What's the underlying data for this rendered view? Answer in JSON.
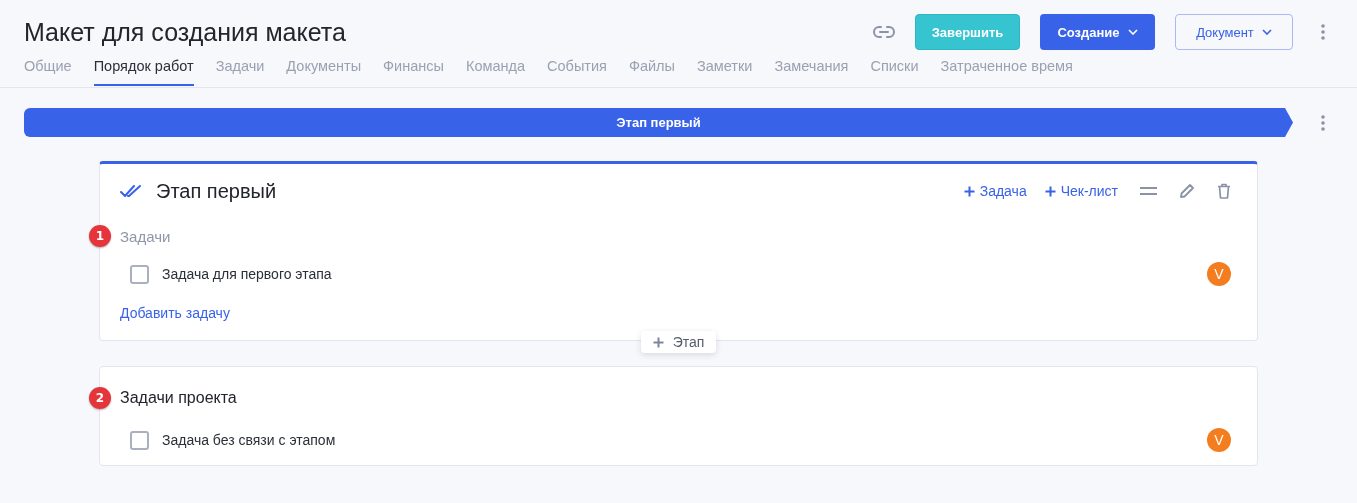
{
  "header": {
    "title": "Макет для создания макета",
    "buttons": [
      {
        "label": "Завершить",
        "kind": "teal",
        "dropdown": false
      },
      {
        "label": "Создание",
        "kind": "primary",
        "dropdown": true
      },
      {
        "label": "Документ",
        "kind": "outline",
        "dropdown": true
      }
    ]
  },
  "tabs": [
    {
      "label": "Общие",
      "selected": false
    },
    {
      "label": "Порядок работ",
      "selected": true
    },
    {
      "label": "Задачи",
      "selected": false
    },
    {
      "label": "Документы",
      "selected": false
    },
    {
      "label": "Финансы",
      "selected": false
    },
    {
      "label": "Команда",
      "selected": false
    },
    {
      "label": "События",
      "selected": false
    },
    {
      "label": "Файлы",
      "selected": false
    },
    {
      "label": "Заметки",
      "selected": false
    },
    {
      "label": "Замечания",
      "selected": false
    },
    {
      "label": "Списки",
      "selected": false
    },
    {
      "label": "Затраченное время",
      "selected": false
    }
  ],
  "stage_bar": {
    "label": "Этап первый"
  },
  "stage_card": {
    "title": "Этап первый",
    "actions": [
      "Задача",
      "Чек-лист"
    ],
    "marker": "1",
    "section_label": "Задачи",
    "tasks": [
      {
        "text": "Задача для первого этапа",
        "checked": false,
        "assignee": "V"
      }
    ],
    "add_link": "Добавить задачу"
  },
  "add_stage_button": "Этап",
  "project_card": {
    "marker": "2",
    "title": "Задачи проекта",
    "tasks": [
      {
        "text": "Задача без связи с этапом",
        "checked": false,
        "assignee": "V"
      }
    ]
  }
}
